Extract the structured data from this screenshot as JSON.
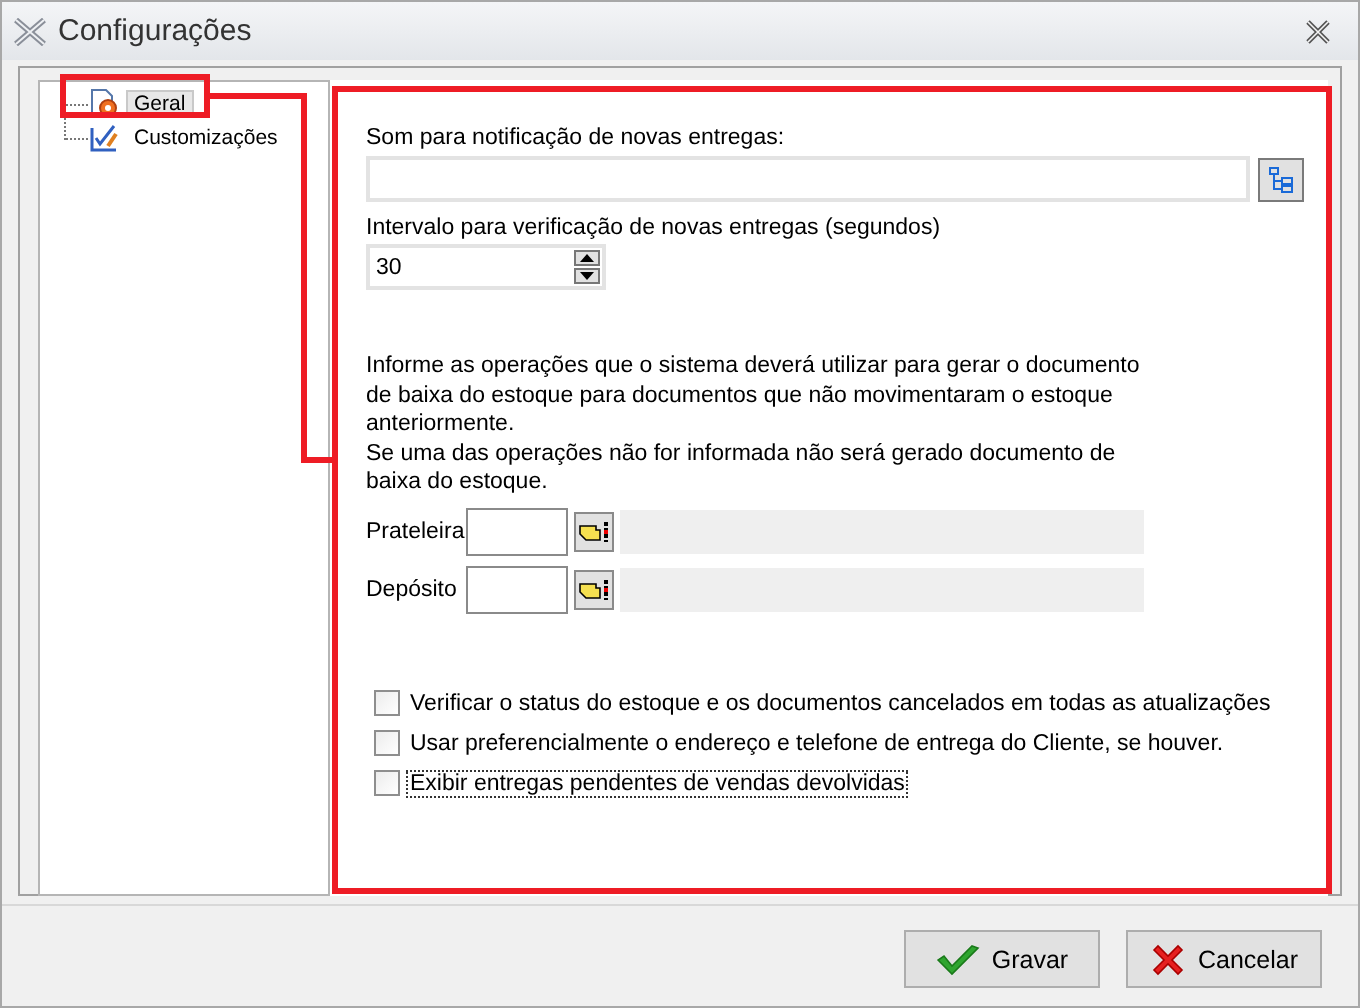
{
  "window": {
    "title": "Configurações"
  },
  "tree": {
    "items": [
      {
        "label": "Geral",
        "selected": true
      },
      {
        "label": "Customizações",
        "selected": false
      }
    ]
  },
  "settings": {
    "sound_label": "Som para notificação de novas entregas:",
    "interval_label": "Intervalo para verificação de novas entregas (segundos)",
    "interval_value": "30",
    "info": [
      {
        "lines": [
          "Informe as operações que o sistema deverá utilizar para gerar o documento",
          "de baixa do estoque para documentos que não movimentaram o estoque",
          "anteriormente."
        ]
      },
      {
        "lines": [
          "Se uma das operações não for informada não será gerado documento de",
          "baixa do estoque."
        ]
      }
    ],
    "lookups": [
      {
        "label": "Prateleira"
      },
      {
        "label": "Depósito"
      }
    ],
    "checkboxes": [
      {
        "label": "Verificar o status do estoque e os documentos cancelados em todas as atualizações",
        "checked": false,
        "focused": false
      },
      {
        "label": "Usar preferencialmente o endereço e telefone de entrega do Cliente, se houver.",
        "checked": false,
        "focused": false
      },
      {
        "label": "Exibir entregas pendentes de vendas devolvidas",
        "checked": false,
        "focused": true
      }
    ]
  },
  "buttons": [
    {
      "label": "Gravar",
      "kind": "ok"
    },
    {
      "label": "Cancelar",
      "kind": "cancel"
    }
  ]
}
